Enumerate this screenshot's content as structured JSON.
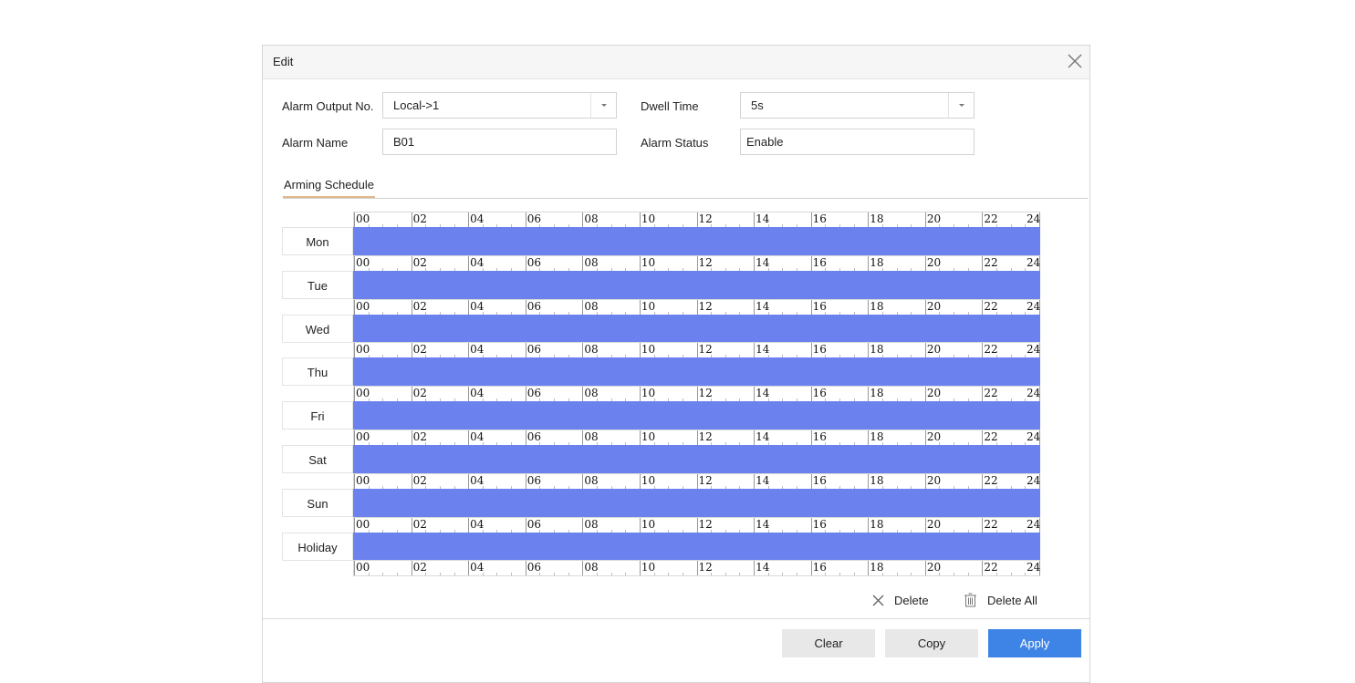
{
  "dialog": {
    "title": "Edit"
  },
  "form": {
    "alarm_output_label": "Alarm Output No.",
    "alarm_output_value": "Local->1",
    "dwell_time_label": "Dwell Time",
    "dwell_time_value": "5s",
    "alarm_name_label": "Alarm Name",
    "alarm_name_value": "B01",
    "alarm_status_label": "Alarm Status",
    "alarm_status_value": "Enable"
  },
  "tabs": [
    {
      "label": "Arming Schedule",
      "active": true
    }
  ],
  "schedule": {
    "hour_labels": [
      "00",
      "02",
      "04",
      "06",
      "08",
      "10",
      "12",
      "14",
      "16",
      "18",
      "20",
      "22",
      "24"
    ],
    "days": [
      {
        "label": "Mon",
        "armed_from_hour": 0,
        "armed_to_hour": 24
      },
      {
        "label": "Tue",
        "armed_from_hour": 0,
        "armed_to_hour": 24
      },
      {
        "label": "Wed",
        "armed_from_hour": 0,
        "armed_to_hour": 24
      },
      {
        "label": "Thu",
        "armed_from_hour": 0,
        "armed_to_hour": 24
      },
      {
        "label": "Fri",
        "armed_from_hour": 0,
        "armed_to_hour": 24
      },
      {
        "label": "Sat",
        "armed_from_hour": 0,
        "armed_to_hour": 24
      },
      {
        "label": "Sun",
        "armed_from_hour": 0,
        "armed_to_hour": 24
      },
      {
        "label": "Holiday",
        "armed_from_hour": 0,
        "armed_to_hour": 24
      }
    ],
    "bar_color": "#6b81ee"
  },
  "schedule_actions": {
    "delete_label": "Delete",
    "delete_all_label": "Delete All"
  },
  "footer": {
    "clear_label": "Clear",
    "copy_label": "Copy",
    "apply_label": "Apply"
  },
  "colors": {
    "accent": "#3d84e6",
    "tab_underline": "#e0b98c"
  }
}
